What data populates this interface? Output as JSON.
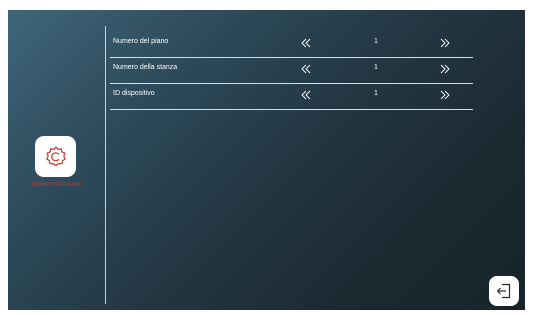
{
  "sidebar": {
    "settings_label": "Numero dell'utente",
    "icon": "gear-icon"
  },
  "rows": [
    {
      "label": "Numero del piano",
      "value": "1"
    },
    {
      "label": "Numero della stanza",
      "value": "1"
    },
    {
      "label": "ID dispositivo",
      "value": "1"
    }
  ],
  "colors": {
    "accent_red": "#c0392b",
    "text": "#ffffff"
  },
  "exit_icon": "exit-icon"
}
